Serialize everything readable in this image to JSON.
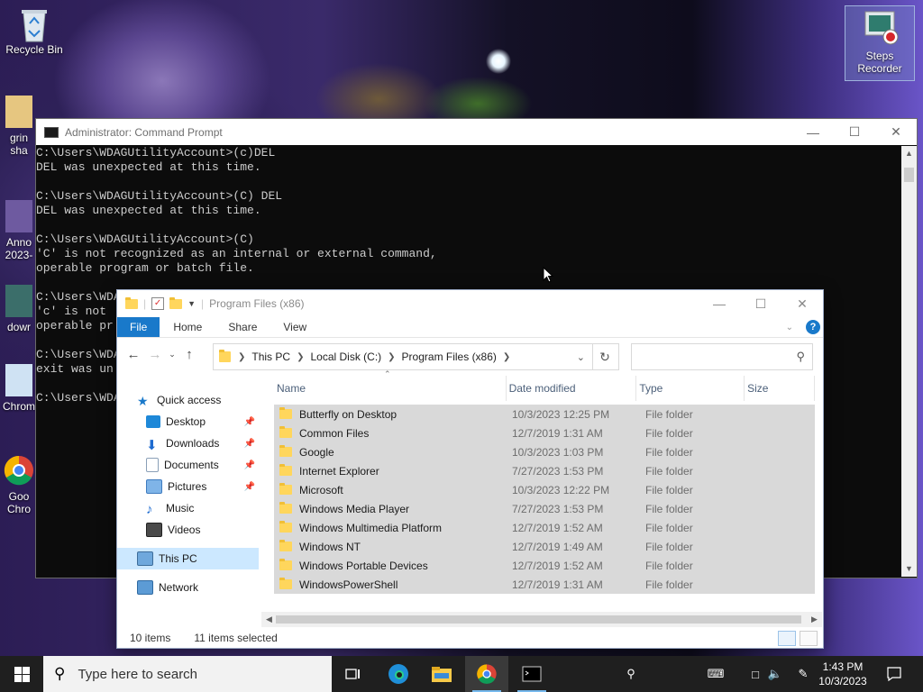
{
  "desktop": {
    "icons": {
      "recycle_bin": "Recycle Bin",
      "grin": "grin sha",
      "anno": "Anno 2023-",
      "down": "dowr",
      "chrome1": "Chrom",
      "google": "Goo Chro",
      "steps_recorder": "Steps Recorder"
    }
  },
  "cmd": {
    "title": "Administrator: Command Prompt",
    "lines": [
      "C:\\Users\\WDAGUtilityAccount>(c)DEL",
      "DEL was unexpected at this time.",
      "",
      "C:\\Users\\WDAGUtilityAccount>(C) DEL",
      "DEL was unexpected at this time.",
      "",
      "C:\\Users\\WDAGUtilityAccount>(C)",
      "'C' is not recognized as an internal or external command,",
      "operable program or batch file.",
      "",
      "C:\\Users\\WDAGUtilityAccount>(c)",
      "'c' is not",
      "operable pr",
      "",
      "C:\\Users\\WDA",
      "exit was un",
      "",
      "C:\\Users\\WDA"
    ]
  },
  "explorer": {
    "title": "Program Files (x86)",
    "tabs": [
      "File",
      "Home",
      "Share",
      "View"
    ],
    "breadcrumb": [
      "This PC",
      "Local Disk (C:)",
      "Program Files (x86)"
    ],
    "search_placeholder": "",
    "nav": {
      "quick_access": "Quick access",
      "desktop": "Desktop",
      "downloads": "Downloads",
      "documents": "Documents",
      "pictures": "Pictures",
      "music": "Music",
      "videos": "Videos",
      "this_pc": "This PC",
      "network": "Network"
    },
    "columns": {
      "name": "Name",
      "date": "Date modified",
      "type": "Type",
      "size": "Size"
    },
    "files": [
      {
        "name": "Butterfly on Desktop",
        "date": "10/3/2023 12:25 PM",
        "type": "File folder"
      },
      {
        "name": "Common Files",
        "date": "12/7/2019 1:31 AM",
        "type": "File folder"
      },
      {
        "name": "Google",
        "date": "10/3/2023 1:03 PM",
        "type": "File folder"
      },
      {
        "name": "Internet Explorer",
        "date": "7/27/2023 1:53 PM",
        "type": "File folder"
      },
      {
        "name": "Microsoft",
        "date": "10/3/2023 12:22 PM",
        "type": "File folder"
      },
      {
        "name": "Windows Media Player",
        "date": "7/27/2023 1:53 PM",
        "type": "File folder"
      },
      {
        "name": "Windows Multimedia Platform",
        "date": "12/7/2019 1:52 AM",
        "type": "File folder"
      },
      {
        "name": "Windows NT",
        "date": "12/7/2019 1:49 AM",
        "type": "File folder"
      },
      {
        "name": "Windows Portable Devices",
        "date": "12/7/2019 1:52 AM",
        "type": "File folder"
      },
      {
        "name": "WindowsPowerShell",
        "date": "12/7/2019 1:31 AM",
        "type": "File folder"
      }
    ],
    "status": {
      "items": "10 items",
      "selected": "11 items selected"
    }
  },
  "taskbar": {
    "search_placeholder": "Type here to search",
    "time": "1:43 PM",
    "date": "10/3/2023"
  },
  "colors": {
    "accent": "#1979ca",
    "selection": "#d9d9d9",
    "taskbar": "#1f1f1f"
  }
}
